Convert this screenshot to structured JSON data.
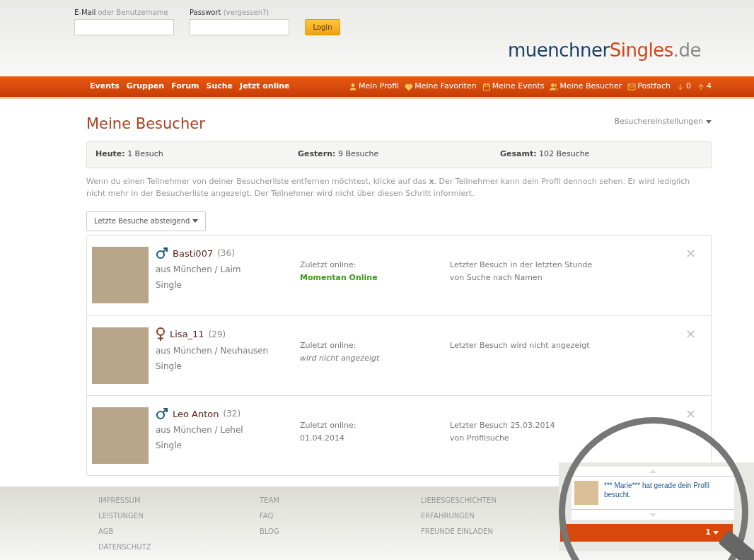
{
  "login": {
    "email_label": "E-Mail",
    "email_hint": "oder Benutzername",
    "password_label": "Passwort",
    "password_hint": "(vergessen?)",
    "button": "Login"
  },
  "logo": {
    "part1": "muenchner",
    "part2": "Singles",
    "part3": ".de"
  },
  "nav": {
    "left": [
      "Events",
      "Gruppen",
      "Forum",
      "Suche",
      "Jetzt online"
    ],
    "right": [
      {
        "kind": "profile",
        "label": "Mein Profil"
      },
      {
        "kind": "favorites",
        "label": "Meine Favoriten"
      },
      {
        "kind": "events",
        "label": "Meine Events"
      },
      {
        "kind": "visitors",
        "label": "Meine Besucher"
      },
      {
        "kind": "mail",
        "label": "Postfach"
      },
      {
        "kind": "down",
        "label": "0"
      },
      {
        "kind": "up",
        "label": "4"
      }
    ]
  },
  "page": {
    "title": "Meine Besucher",
    "settings": "Besuchereinstellungen"
  },
  "stats": [
    {
      "label": "Heute:",
      "value": "1 Besuch"
    },
    {
      "label": "Gestern:",
      "value": "9 Besuche"
    },
    {
      "label": "Gesamt:",
      "value": "102 Besuche"
    }
  ],
  "info": "Wenn du einen Teilnehmer von deiner Besucherliste entfernen möchtest, klicke auf das **x**. Der Teilnehmer kann dein Profil dennoch sehen. Er wird lediglich nicht mehr in der Besucherliste angezeigt. Der Teilnehmer wird nicht über diesen Schritt informiert.",
  "sort": "Letzte Besuche absteigend",
  "visitors": [
    {
      "kind": "male",
      "name": "Basti007",
      "age": "(36)",
      "location": "aus München / Laim",
      "status": "Single",
      "online_label": "Zuletzt online:",
      "online": {
        "kind": "online",
        "text": "Momentan Online"
      },
      "visit": "Letzter Besuch in der letzten Stunde",
      "source": "von Suche nach Namen",
      "remove": "×"
    },
    {
      "kind": "female",
      "name": "Lisa_11",
      "age": "(29)",
      "location": "aus München / Neuhausen",
      "status": "Single",
      "online_label": "Zuletzt online:",
      "online": {
        "kind": "hidden",
        "text": "wird nicht angezeigt"
      },
      "visit": "Letzter Besuch wird nicht angezeigt",
      "remove": "×"
    },
    {
      "kind": "male",
      "name": "Leo Anton",
      "age": "(32)",
      "location": "aus München / Lehel",
      "status": "Single",
      "online_label": "Zuletzt online:",
      "online": {
        "kind": "date",
        "text": "01.04.2014"
      },
      "visit": "Letzter Besuch 25.03.2014",
      "source": "von Profilsuche",
      "remove": "×"
    }
  ],
  "footer": [
    [
      "IMPRESSUM",
      "LEISTUNGEN",
      "AGB",
      "DATENSCHUTZ"
    ],
    [
      "TEAM",
      "FAQ",
      "BLOG"
    ],
    [
      "LIEBESGESCHICHTEN",
      "ERFAHRUNGEN",
      "FREUNDE EINLADEN"
    ]
  ],
  "notification": {
    "message": "*** Marie*** hat gerade dein Profil besucht.",
    "count": "1"
  }
}
